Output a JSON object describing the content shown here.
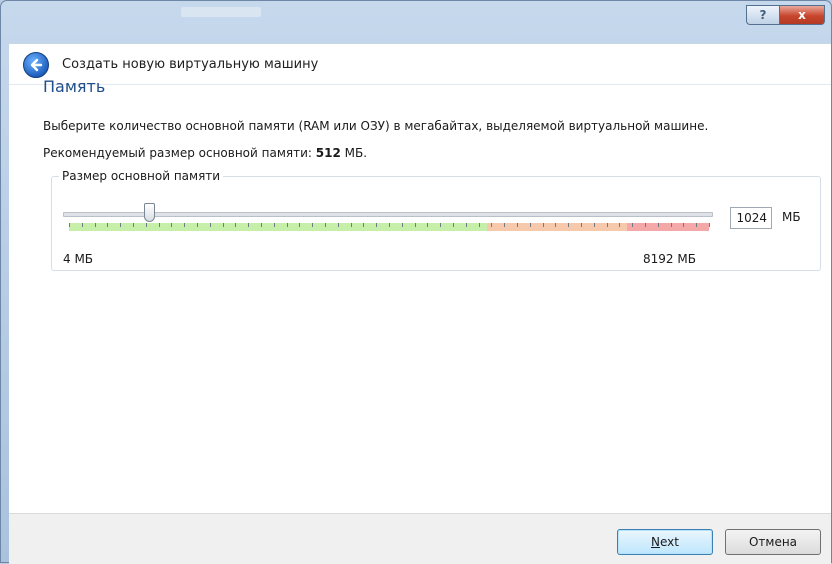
{
  "window": {
    "help_glyph": "?",
    "close_glyph": "x"
  },
  "wizard": {
    "title": "Создать новую виртуальную машину",
    "back_icon": "back-arrow-icon"
  },
  "page": {
    "title": "Память",
    "description": "Выберите количество основной памяти (RAM или ОЗУ) в мегабайтах, выделяемой виртуальной машине.",
    "recommended_prefix": "Рекомендуемый размер основной памяти: ",
    "recommended_value": "512",
    "recommended_suffix": " МБ."
  },
  "memory": {
    "group_label": "Размер основной памяти",
    "value": "1024",
    "unit": "МБ",
    "min_label": "4 МБ",
    "max_label": "8192 МБ",
    "slider_fraction": 0.125,
    "colors": {
      "green": "#c6f0a9",
      "orange": "#f6c9ad",
      "red": "#f4a8a8"
    }
  },
  "buttons": {
    "next_accel": "N",
    "next_rest": "ext",
    "cancel": "Отмена"
  },
  "colors": {
    "page_title": "#1f4e8a",
    "close_button": "#c8452d"
  }
}
